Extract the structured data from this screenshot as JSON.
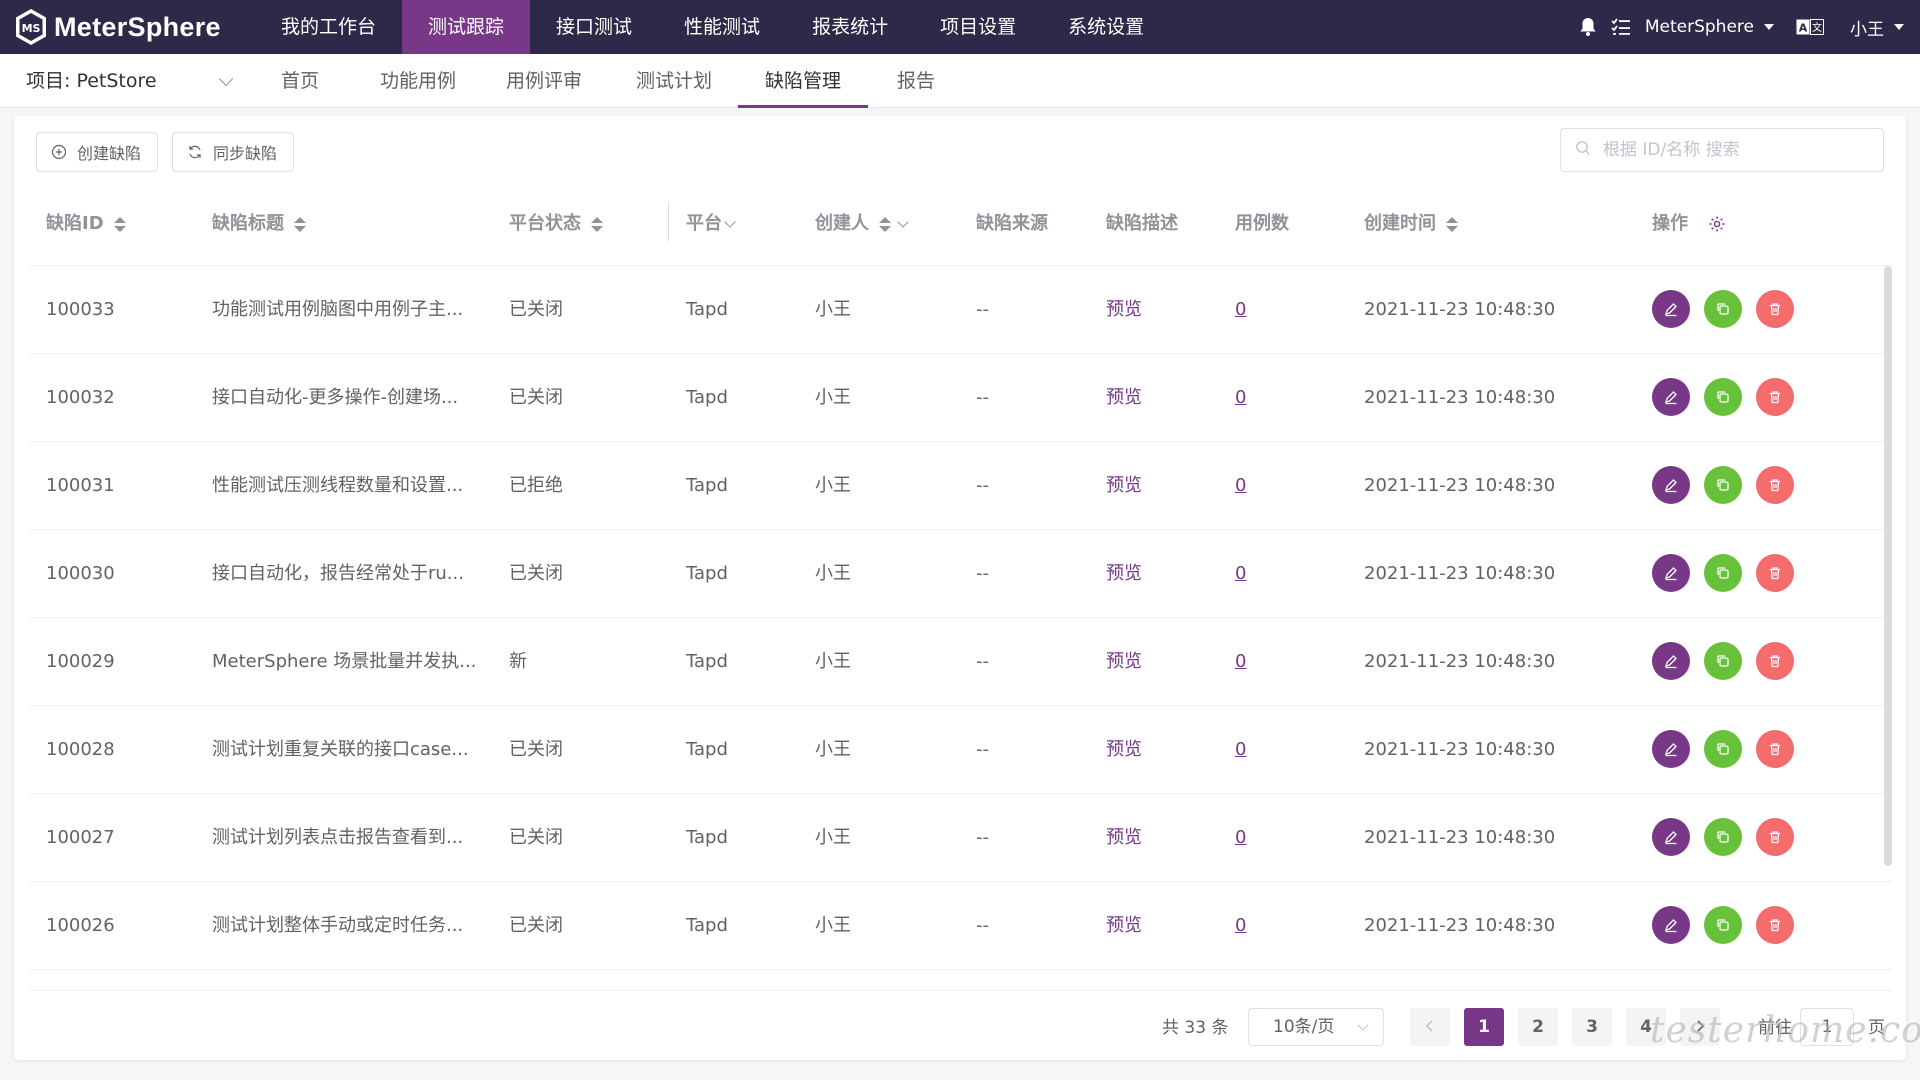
{
  "app": {
    "brand": "MeterSphere",
    "accent": "#783887",
    "topbar_bg": "#2c2a48"
  },
  "topnav": [
    "我的工作台",
    "测试跟踪",
    "接口测试",
    "性能测试",
    "报表统计",
    "项目设置",
    "系统设置"
  ],
  "topnav_active": 1,
  "topright": {
    "workspace": "MeterSphere",
    "user": "小王",
    "lang_icon": "language-icon",
    "bell_icon": "bell-icon",
    "task_icon": "task-list-icon"
  },
  "subnav": {
    "project_label": "项目: PetStore",
    "tabs": [
      "首页",
      "功能用例",
      "用例评审",
      "测试计划",
      "缺陷管理",
      "报告"
    ],
    "active": 4
  },
  "toolbar": {
    "create": "创建缺陷",
    "sync": "同步缺陷",
    "search_placeholder": "根据 ID/名称 搜索"
  },
  "table": {
    "headers": {
      "id": "缺陷ID",
      "title": "缺陷标题",
      "status": "平台状态",
      "platform": "平台",
      "creator": "创建人",
      "source": "缺陷来源",
      "desc": "缺陷描述",
      "cases": "用例数",
      "created": "创建时间",
      "ops": "操作"
    },
    "rows": [
      {
        "id": "100033",
        "title": "功能测试用例脑图中用例子主...",
        "status": "已关闭",
        "platform": "Tapd",
        "creator": "小王",
        "source": "--",
        "desc": "预览",
        "cases": "0",
        "created": "2021-11-23 10:48:30"
      },
      {
        "id": "100032",
        "title": "接口自动化-更多操作-创建场...",
        "status": "已关闭",
        "platform": "Tapd",
        "creator": "小王",
        "source": "--",
        "desc": "预览",
        "cases": "0",
        "created": "2021-11-23 10:48:30"
      },
      {
        "id": "100031",
        "title": "性能测试压测线程数量和设置...",
        "status": "已拒绝",
        "platform": "Tapd",
        "creator": "小王",
        "source": "--",
        "desc": "预览",
        "cases": "0",
        "created": "2021-11-23 10:48:30"
      },
      {
        "id": "100030",
        "title": "接口自动化，报告经常处于ru...",
        "status": "已关闭",
        "platform": "Tapd",
        "creator": "小王",
        "source": "--",
        "desc": "预览",
        "cases": "0",
        "created": "2021-11-23 10:48:30"
      },
      {
        "id": "100029",
        "title": "MeterSphere 场景批量并发执...",
        "status": "新",
        "platform": "Tapd",
        "creator": "小王",
        "source": "--",
        "desc": "预览",
        "cases": "0",
        "created": "2021-11-23 10:48:30"
      },
      {
        "id": "100028",
        "title": "测试计划重复关联的接口case...",
        "status": "已关闭",
        "platform": "Tapd",
        "creator": "小王",
        "source": "--",
        "desc": "预览",
        "cases": "0",
        "created": "2021-11-23 10:48:30"
      },
      {
        "id": "100027",
        "title": "测试计划列表点击报告查看到...",
        "status": "已关闭",
        "platform": "Tapd",
        "creator": "小王",
        "source": "--",
        "desc": "预览",
        "cases": "0",
        "created": "2021-11-23 10:48:30"
      },
      {
        "id": "100026",
        "title": "测试计划整体手动或定时任务...",
        "status": "已关闭",
        "platform": "Tapd",
        "creator": "小王",
        "source": "--",
        "desc": "预览",
        "cases": "0",
        "created": "2021-11-23 10:48:30"
      }
    ]
  },
  "pagination": {
    "total": "共 33 条",
    "page_size": "10条/页",
    "pages": [
      "1",
      "2",
      "3",
      "4"
    ],
    "current": "1",
    "goto_label": "前往",
    "goto_value": "1",
    "page_suffix": "页"
  },
  "watermark": "testerhome.com"
}
